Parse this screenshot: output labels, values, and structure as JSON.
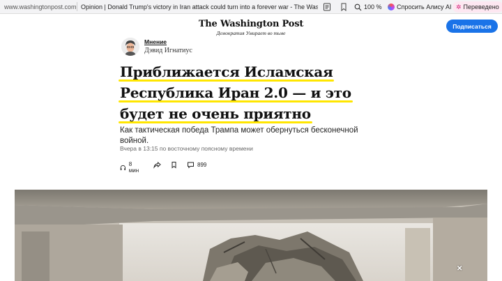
{
  "browser": {
    "domain": "www.washingtonpost.com",
    "tab_title": "Opinion | Donald Trump's victory in Iran attack could turn into a forever war - The Washingt...",
    "zoom": "100 %",
    "alice_label": "Спросить Алису AI",
    "translated_label": "Переведено",
    "icons": [
      "reader-mode-icon",
      "bookmark-icon",
      "zoom-icon",
      "alice-icon",
      "translate-icon"
    ]
  },
  "header": {
    "logo": "The Washington Post",
    "tagline": "Демократия Умирает во тьме",
    "subscribe_label": "Подписаться",
    "accent": "#1a73e8"
  },
  "article": {
    "section": "Мнение",
    "author": "Дэвид Игнатиус",
    "headline_lines": [
      "Приближается Исламская",
      "Республика Иран 2.0 — и это",
      "будет не очень приятно"
    ],
    "highlight_color": "#ffe600",
    "subheadline": "Как тактическая победа Трампа может обернуться бесконечной войной.",
    "timestamp": "Вчера в 13:15 по восточному поясному времени",
    "read_time": "8 мин",
    "comments": "899"
  }
}
